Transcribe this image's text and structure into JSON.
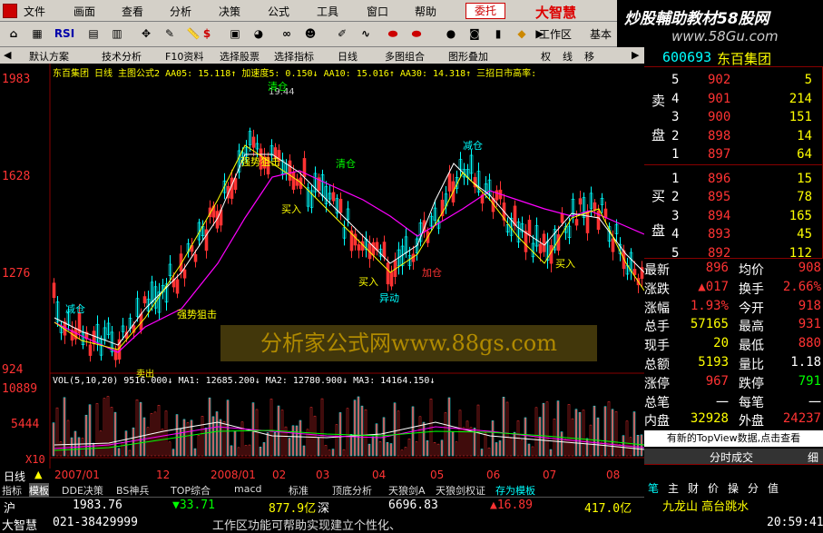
{
  "menu": {
    "items": [
      "文件",
      "画面",
      "查看",
      "分析",
      "决策",
      "公式",
      "工具",
      "窗口",
      "帮助"
    ],
    "entrust": "委托",
    "brand": "大智慧"
  },
  "banner": {
    "line1": "炒股輔助教材58股网",
    "line2": "www.58Gu.com"
  },
  "toolbar": {
    "rsi": "RSI",
    "workarea": "工作区",
    "basic": "基本"
  },
  "tabs": [
    "默认方案",
    "技术分析",
    "F10资料",
    "选择股票",
    "选择指标",
    "日线",
    "多图组合",
    "图形叠加",
    "权",
    "线",
    "移"
  ],
  "chart": {
    "header": "东百集团 日线 主图公式2 AA05: 15.118↑ 加速度5: 0.150↓ AA10: 15.016↑ AA30: 14.318↑ 三招日市高率:",
    "price_ticks": [
      "1983",
      "1628",
      "1276",
      "924"
    ],
    "peak_label": "19.44",
    "vol_header": "VOL(5,10,20) 9516.000↓ MA1: 12685.200↓ MA2: 12780.900↓ MA3: 14164.150↓",
    "vol_ticks": [
      "10889",
      "5444",
      "X10"
    ],
    "annotations": [
      "减仓",
      "清仓",
      "强势狙击",
      "买入",
      "加仓",
      "异动",
      "减仓",
      "清仓",
      "买入",
      "强势狙击",
      "卖出",
      "买入"
    ],
    "watermark": "分析家公式网www.88gs.com",
    "date_labels": [
      "2007/01",
      "12",
      "2008/01",
      "02",
      "03",
      "04",
      "05",
      "06",
      "07",
      "08"
    ],
    "period": "日线",
    "chart_data": {
      "type": "candlestick",
      "ylim": [
        924,
        1983
      ],
      "y_ticks": [
        924,
        1276,
        1628,
        1983
      ]
    }
  },
  "bottom_tabs": [
    "指标",
    "模板",
    "DDE决策",
    "BS神兵",
    "TOP综合",
    "macd",
    "标准",
    "顶底分析",
    "天狼剑A",
    "天狼剑权证",
    "存为模板"
  ],
  "status": {
    "sh_label": "沪",
    "sh_index": "1983.76",
    "sh_change": "▼33.71",
    "sh_amount": "877.9亿",
    "sz_label": "深",
    "sz_index": "6696.83",
    "sz_change": "▲16.89",
    "sz_amount": "417.0亿",
    "phone_label": "大智慧",
    "phone": "021-38429999",
    "scroll_text": "工作区功能可帮助实现建立个性化、",
    "ticker": "九龙山 高台跳水",
    "time": "20:59:41"
  },
  "quote": {
    "code": "600693",
    "name": "东百集团",
    "sell_label": [
      "卖",
      "盘"
    ],
    "buy_label": [
      "买",
      "盘"
    ],
    "sell": [
      {
        "lvl": "5",
        "price": "902",
        "vol": "5"
      },
      {
        "lvl": "4",
        "price": "901",
        "vol": "214"
      },
      {
        "lvl": "3",
        "price": "900",
        "vol": "151"
      },
      {
        "lvl": "2",
        "price": "898",
        "vol": "14"
      },
      {
        "lvl": "1",
        "price": "897",
        "vol": "64"
      }
    ],
    "buy": [
      {
        "lvl": "1",
        "price": "896",
        "vol": "15"
      },
      {
        "lvl": "2",
        "price": "895",
        "vol": "78"
      },
      {
        "lvl": "3",
        "price": "894",
        "vol": "165"
      },
      {
        "lvl": "4",
        "price": "893",
        "vol": "45"
      },
      {
        "lvl": "5",
        "price": "892",
        "vol": "112"
      }
    ],
    "stats": [
      {
        "l1": "最新",
        "v1": "896",
        "l2": "均价",
        "v2": "908"
      },
      {
        "l1": "涨跌",
        "v1": "▲017",
        "l2": "换手",
        "v2": "2.66%"
      },
      {
        "l1": "涨幅",
        "v1": "1.93%",
        "l2": "今开",
        "v2": "918"
      },
      {
        "l1": "总手",
        "v1": "57165",
        "l2": "最高",
        "v2": "931"
      },
      {
        "l1": "现手",
        "v1": "20",
        "l2": "最低",
        "v2": "880"
      },
      {
        "l1": "总额",
        "v1": "5193",
        "l2": "量比",
        "v2": "1.18"
      },
      {
        "l1": "涨停",
        "v1": "967",
        "l2": "跌停",
        "v2": "791"
      },
      {
        "l1": "总笔",
        "v1": "一",
        "l2": "每笔",
        "v2": "一"
      },
      {
        "l1": "内盘",
        "v1": "32928",
        "l2": "外盘",
        "v2": "24237"
      }
    ],
    "topview": "有新的TopView数据,点击查看",
    "timeshare": "分时成交",
    "timeshare_right": "细",
    "subtabs": [
      "笔",
      "主",
      "财",
      "价",
      "操",
      "分",
      "值"
    ]
  }
}
